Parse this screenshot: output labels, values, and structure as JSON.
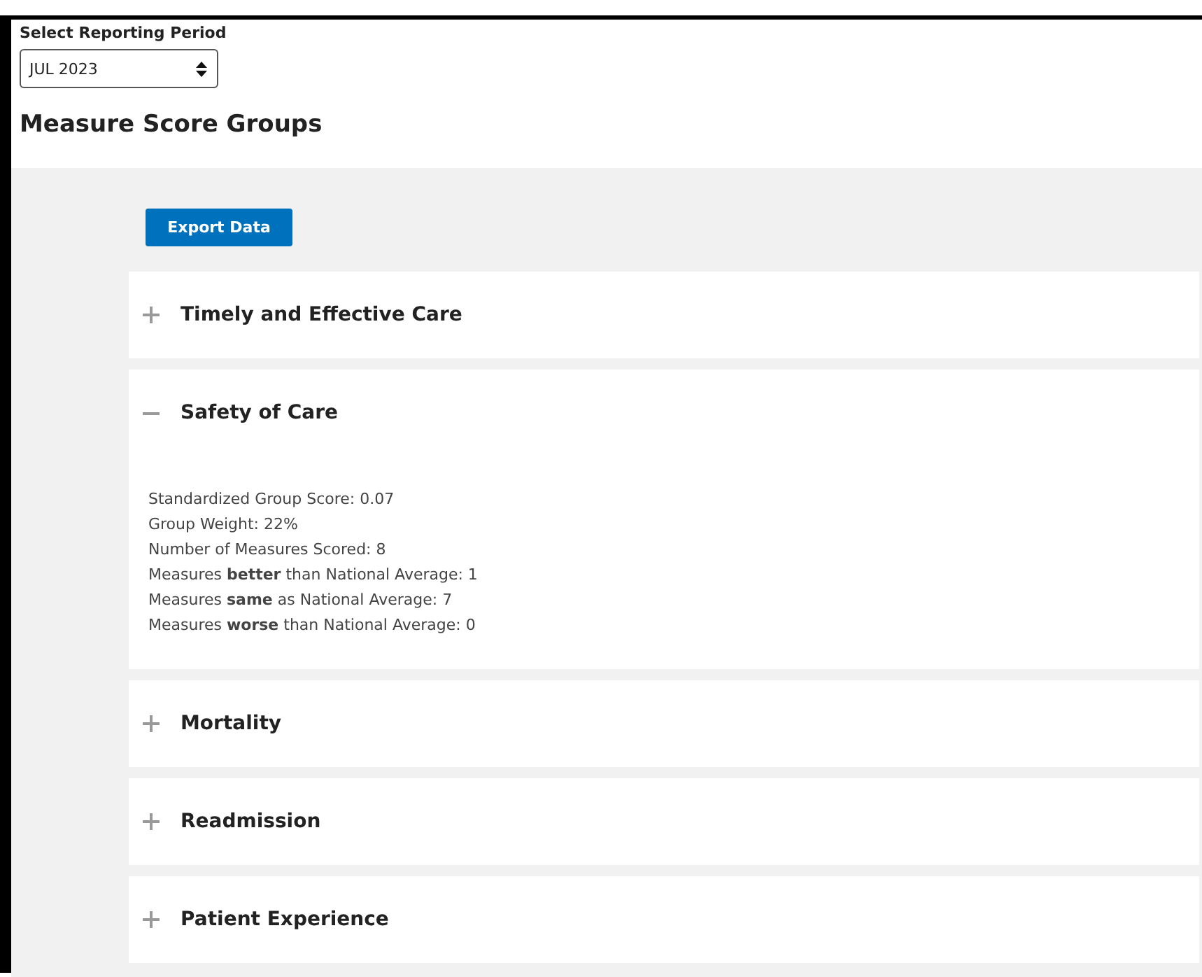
{
  "period_selector": {
    "label": "Select Reporting Period",
    "value": "JUL 2023"
  },
  "heading": "Measure Score Groups",
  "export_button": "Export Data",
  "groups": [
    {
      "title": "Timely and Effective Care",
      "expanded": false
    },
    {
      "title": "Safety of Care",
      "expanded": true,
      "details": [
        "Standardized Group Score: 0.07",
        "Group Weight: 22%",
        "Number of Measures Scored: 8",
        "Measures **better** than National Average: 1",
        "Measures **same** as National Average: 7",
        "Measures **worse** than National Average: 0"
      ]
    },
    {
      "title": "Mortality",
      "expanded": false
    },
    {
      "title": "Readmission",
      "expanded": false
    },
    {
      "title": "Patient Experience",
      "expanded": false
    }
  ]
}
